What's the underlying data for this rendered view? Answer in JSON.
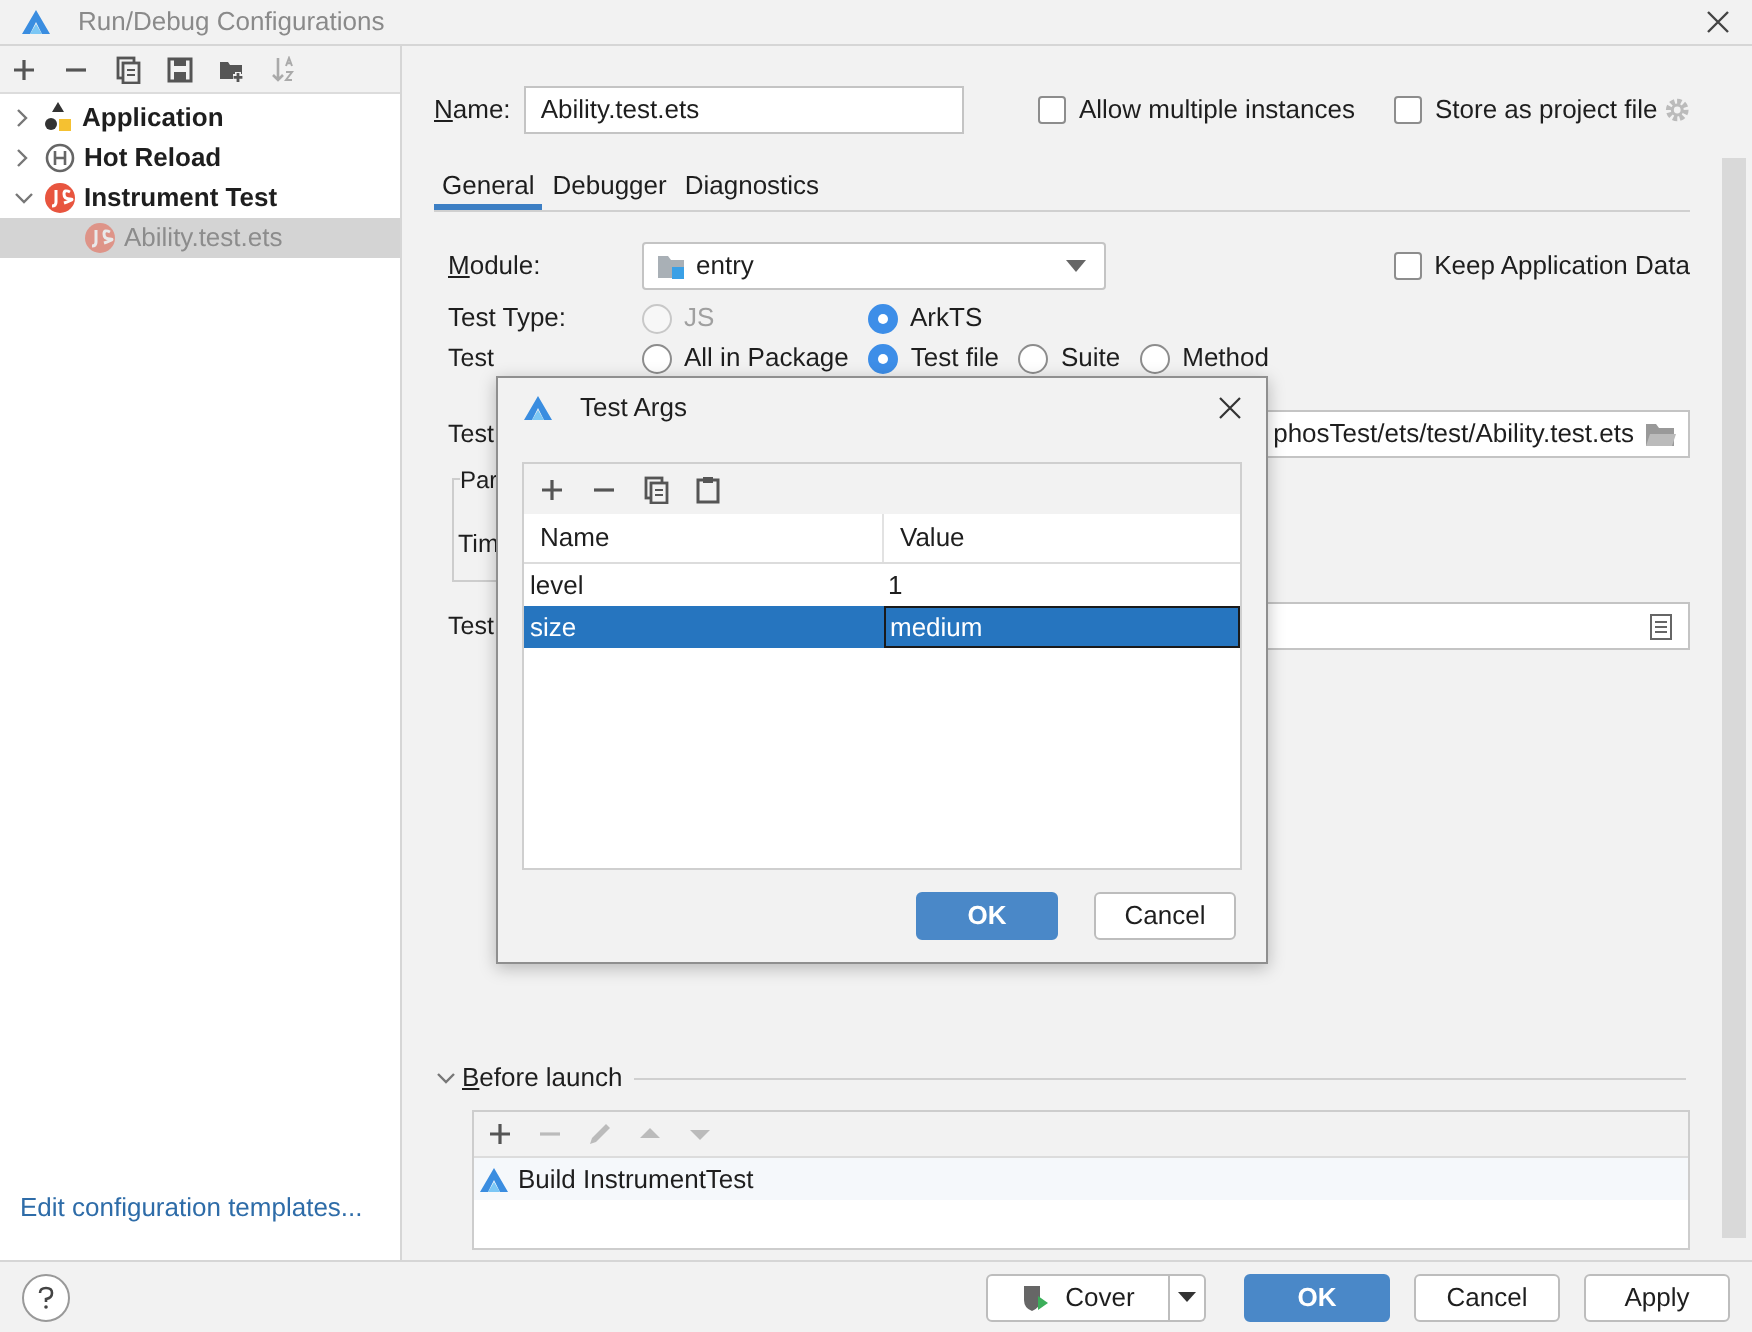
{
  "window": {
    "title": "Run/Debug Configurations"
  },
  "sidebar": {
    "items": [
      {
        "label": "Application",
        "kind": "application",
        "expanded": false,
        "selected": false
      },
      {
        "label": "Hot Reload",
        "kind": "hot-reload",
        "expanded": false,
        "selected": false
      },
      {
        "label": "Instrument Test",
        "kind": "js",
        "expanded": true,
        "selected": false,
        "children": [
          {
            "label": "Ability.test.ets",
            "kind": "js",
            "selected": true,
            "temporary": true
          }
        ]
      }
    ],
    "footer_link": "Edit configuration templates..."
  },
  "name_field": {
    "label": "Name:",
    "value": "Ability.test.ets"
  },
  "options": [
    {
      "label": "Allow multiple instances",
      "checked": false
    },
    {
      "label": "Store as project file",
      "checked": false
    }
  ],
  "tabs": [
    {
      "label": "General",
      "selected": true
    },
    {
      "label": "Debugger",
      "selected": false
    },
    {
      "label": "Diagnostics",
      "selected": false
    }
  ],
  "module": {
    "label": "Module:",
    "value": "entry"
  },
  "keep_app_data": {
    "label": "Keep Application Data",
    "checked": false
  },
  "test_type": {
    "label": "Test Type:",
    "options": [
      {
        "label": "JS",
        "selected": false,
        "disabled": true
      },
      {
        "label": "ArkTS",
        "selected": true,
        "disabled": false
      }
    ]
  },
  "test_scope": {
    "label": "Test",
    "options": [
      {
        "label": "All in Package",
        "selected": false
      },
      {
        "label": "Test file",
        "selected": true
      },
      {
        "label": "Suite",
        "selected": false
      },
      {
        "label": "Method",
        "selected": false
      }
    ]
  },
  "test_file": {
    "label": "Test",
    "value": "phosTest/ets/test/Ability.test.ets"
  },
  "parameters": {
    "label": "Par",
    "row_label": "Tim"
  },
  "test_args": {
    "label": "Test"
  },
  "before_launch": {
    "label": "Before launch",
    "expanded": true,
    "tasks": [
      {
        "label": "Build InstrumentTest"
      }
    ]
  },
  "footer_buttons": [
    {
      "label": "Cover",
      "kind": "split"
    },
    {
      "label": "OK",
      "kind": "primary"
    },
    {
      "label": "Cancel",
      "kind": "normal"
    },
    {
      "label": "Apply",
      "kind": "normal"
    }
  ],
  "dialog": {
    "title": "Test Args",
    "columns": [
      "Name",
      "Value"
    ],
    "rows": [
      {
        "cells": [
          "level",
          "1"
        ],
        "selected": false
      },
      {
        "cells": [
          "size",
          "medium"
        ],
        "selected": true
      }
    ],
    "buttons": [
      {
        "label": "OK",
        "kind": "primary"
      },
      {
        "label": "Cancel",
        "kind": "normal"
      }
    ]
  }
}
